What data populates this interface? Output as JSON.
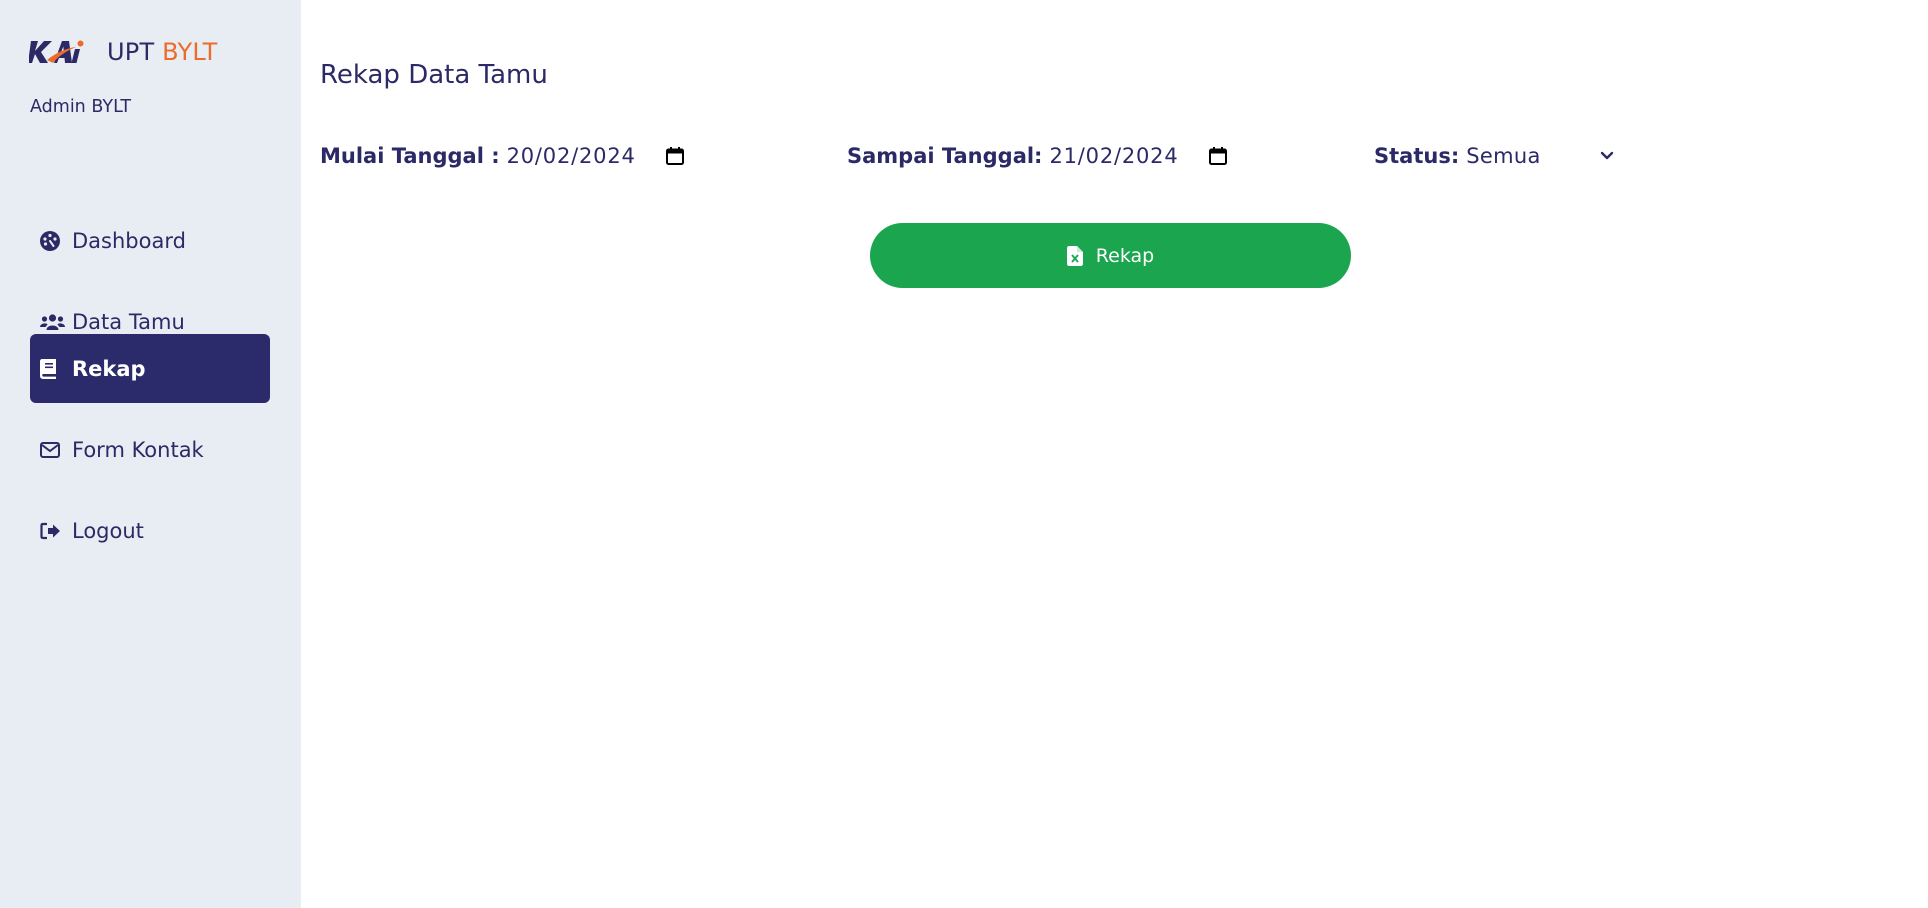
{
  "brand": {
    "logo_text": "KAi",
    "upt": "UPT",
    "bylt": "BYLT"
  },
  "user": {
    "role_label": "Admin BYLT"
  },
  "sidebar": {
    "items": [
      {
        "label": "Dashboard",
        "icon": "palette-icon",
        "active": false
      },
      {
        "label": "Data Tamu",
        "icon": "users-icon",
        "active": false
      },
      {
        "label": "Rekap",
        "icon": "book-icon",
        "active": true
      },
      {
        "label": "Form Kontak",
        "icon": "envelope-icon",
        "active": false
      },
      {
        "label": "Logout",
        "icon": "sign-out-icon",
        "active": false
      }
    ]
  },
  "main": {
    "title": "Rekap Data Tamu",
    "filters": {
      "start": {
        "label": "Mulai Tanggal :",
        "value": "20/02/2024"
      },
      "end": {
        "label": "Sampai Tanggal:",
        "value": "21/02/2024"
      },
      "status": {
        "label": "Status:",
        "value": "Semua"
      }
    },
    "button": {
      "label": "Rekap",
      "icon": "file-excel-icon"
    }
  },
  "colors": {
    "primary": "#2b2a6a",
    "accent": "#ec6b2b",
    "button": "#1aa54e",
    "sidebar_bg": "#e8edf3"
  }
}
